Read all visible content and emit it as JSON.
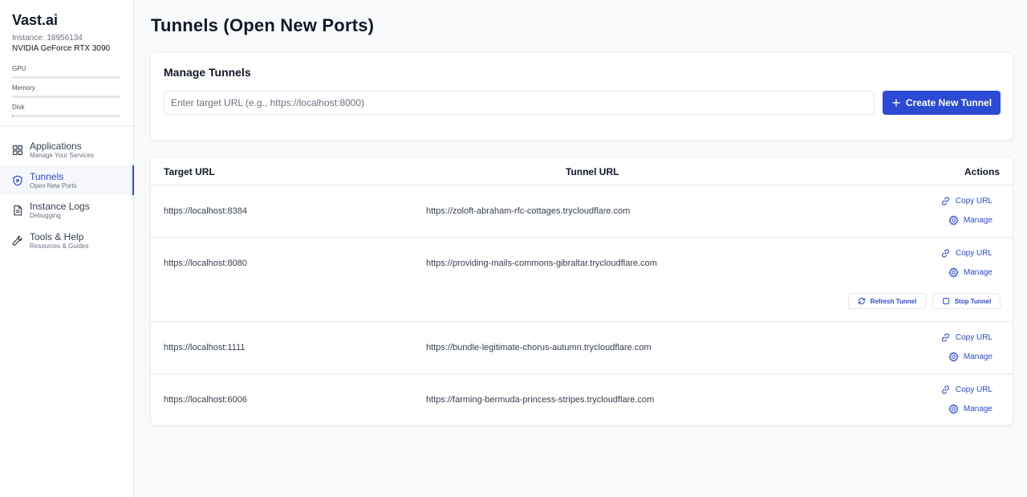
{
  "sidebar": {
    "brand": "Vast.ai",
    "instance": "Instance: 18956134",
    "gpu_model": "NVIDIA GeForce RTX 3090",
    "meters": [
      {
        "label": "GPU",
        "fill": 0
      },
      {
        "label": "Memory",
        "fill": 0
      },
      {
        "label": "Disk",
        "fill": 0.01
      }
    ],
    "nav": [
      {
        "label": "Applications",
        "sub": "Manage Your Services",
        "icon": "grid-icon"
      },
      {
        "label": "Tunnels",
        "sub": "Open New Ports",
        "icon": "shield-icon",
        "active": true
      },
      {
        "label": "Instance Logs",
        "sub": "Debugging",
        "icon": "document-icon"
      },
      {
        "label": "Tools & Help",
        "sub": "Resources & Guides",
        "icon": "wrench-icon"
      }
    ]
  },
  "page": {
    "title": "Tunnels (Open New Ports)"
  },
  "manage": {
    "title": "Manage Tunnels",
    "input_placeholder": "Enter target URL (e.g., https://localhost:8000)",
    "input_value": "",
    "create_label": "Create New Tunnel"
  },
  "table": {
    "headers": {
      "target": "Target URL",
      "tunnel": "Tunnel URL",
      "actions": "Actions"
    },
    "rows": [
      {
        "target": "https://localhost:8384",
        "tunnel": "https://zoloft-abraham-rfc-cottages.trycloudflare.com"
      },
      {
        "target": "https://localhost:8080",
        "tunnel": "https://providing-mails-commons-gibraltar.trycloudflare.com"
      },
      {
        "target": "https://localhost:1111",
        "tunnel": "https://bundle-legitimate-chorus-autumn.trycloudflare.com"
      },
      {
        "target": "https://localhost:6006",
        "tunnel": "https://farming-bermuda-princess-stripes.trycloudflare.com"
      }
    ],
    "copy_label": "Copy URL",
    "manage_label": "Manage",
    "refresh_label": "Refresh Tunnel",
    "stop_label": "Stop Tunnel"
  },
  "colors": {
    "accent": "#2d4ad4",
    "text": "#111827",
    "muted": "#6b7280",
    "border": "#e5e7eb",
    "background": "#f9fafb"
  }
}
